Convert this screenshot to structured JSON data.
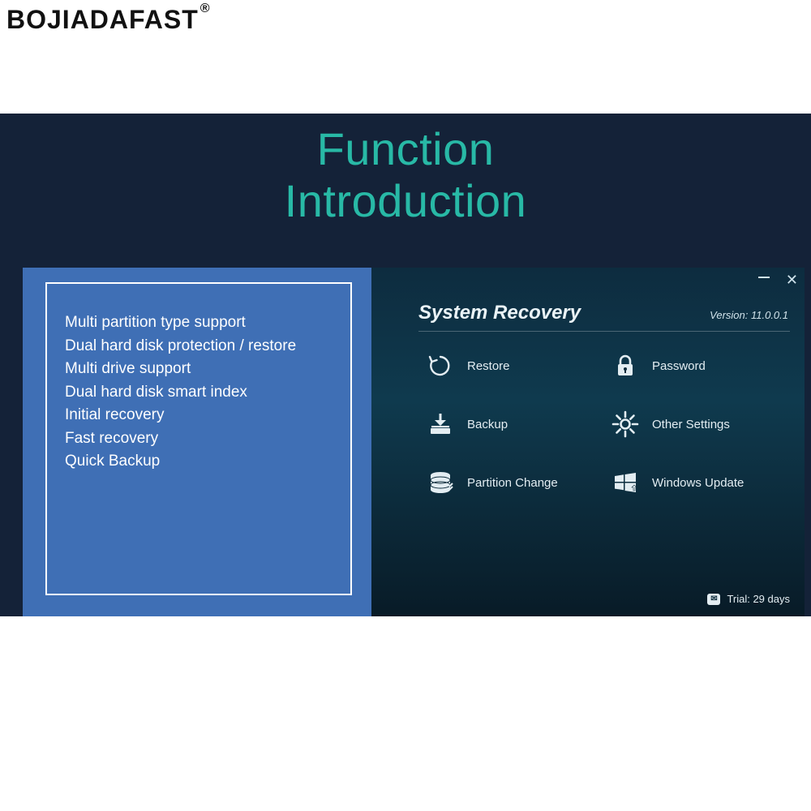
{
  "brand": {
    "name": "BOJIADAFAST",
    "registered": "®"
  },
  "heading": {
    "line1": "Function",
    "line2": "Introduction"
  },
  "features": [
    "Multi partition type support",
    "Dual hard disk protection / restore",
    "Multi drive support",
    "Dual hard disk smart index",
    "Initial recovery",
    "Fast recovery",
    "Quick Backup"
  ],
  "app": {
    "title": "System Recovery",
    "version_label": "Version: 11.0.0.1",
    "trial_label": "Trial: 29 days",
    "menu": {
      "restore": "Restore",
      "password": "Password",
      "backup": "Backup",
      "other_settings": "Other Settings",
      "partition_change": "Partition Change",
      "windows_update": "Windows Update"
    }
  },
  "window_controls": {
    "close_glyph": "✕"
  }
}
